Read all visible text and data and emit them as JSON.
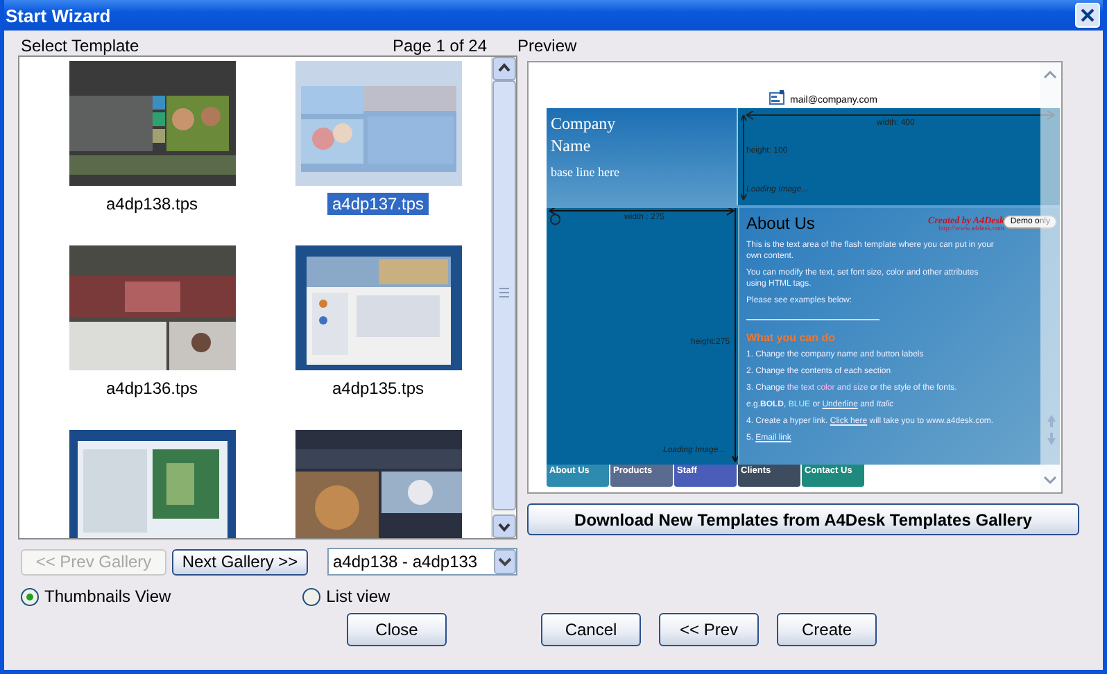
{
  "window": {
    "title": "Start Wizard"
  },
  "select_label": "Select Template",
  "page_label": "Page 1 of 24",
  "preview_label": "Preview",
  "templates": [
    {
      "label": "a4dp138.tps",
      "selected": false
    },
    {
      "label": "a4dp137.tps",
      "selected": true
    },
    {
      "label": "a4dp136.tps",
      "selected": false
    },
    {
      "label": "a4dp135.tps",
      "selected": false
    },
    {
      "selected": false
    },
    {
      "selected": false
    }
  ],
  "preview": {
    "email": "mail@company.com",
    "company_lines": [
      "Company",
      "Name"
    ],
    "baseline": "base line here",
    "banner": {
      "width_label": "width: 400",
      "height_label": "height: 100",
      "loading": "Loading Image..."
    },
    "side_image": {
      "letter": "O",
      "width_label": "width : 275",
      "height_label": "height:275",
      "loading": "Loading Image..."
    },
    "title": "About Us",
    "credit": "Created by A4Desk",
    "credit_url": "http://www.a4desk.com",
    "demo_badge": "Demo only",
    "paragraphs": [
      "This is the text area of the flash template where you can put in your own content.",
      "You can modify the text, set font size, color and other attributes using HTML tags.",
      "Please see examples below:"
    ],
    "subheading": "What you can do",
    "steps": [
      [
        {
          "kind": "plain",
          "text": "1. Change the company name and button labels"
        }
      ],
      [
        {
          "kind": "plain",
          "text": "2. Change the contents of each section"
        }
      ],
      [
        {
          "kind": "plain",
          "text": "3. Change "
        },
        {
          "kind": "colored",
          "text": "the text ",
          "color": "#e0d8ff"
        },
        {
          "kind": "colored",
          "text": "color ",
          "color": "#ffb0e8"
        },
        {
          "kind": "colored",
          "text": "and size",
          "color": "#e0d8ff"
        },
        {
          "kind": "plain",
          "text": " or the style of the fonts."
        }
      ],
      [
        {
          "kind": "plain",
          "text": "e.g."
        },
        {
          "kind": "bold",
          "text": "BOLD"
        },
        {
          "kind": "plain",
          "text": ", "
        },
        {
          "kind": "colored",
          "text": "BLUE",
          "color": "#a0f4ff"
        },
        {
          "kind": "plain",
          "text": "  or "
        },
        {
          "kind": "underline",
          "text": "Underline"
        },
        {
          "kind": "plain",
          "text": " and "
        },
        {
          "kind": "italic",
          "text": "Italic"
        }
      ],
      [
        {
          "kind": "plain",
          "text": "4. Create a hyper link. "
        },
        {
          "kind": "link",
          "text": "Click here"
        },
        {
          "kind": "plain",
          "text": " will take you to www.a4desk.com."
        }
      ],
      [
        {
          "kind": "plain",
          "text": "5. "
        },
        {
          "kind": "link",
          "text": "Email link"
        }
      ]
    ],
    "nav": [
      {
        "label": "About Us",
        "color": "#2e8bb0"
      },
      {
        "label": "Products",
        "color": "#5b6b90"
      },
      {
        "label": "Staff",
        "color": "#4a5db8"
      },
      {
        "label": "Clients",
        "color": "#3d4c5e"
      },
      {
        "label": "Contact Us",
        "color": "#1e8a7e"
      }
    ]
  },
  "download_button": "Download New Templates from A4Desk Templates Gallery",
  "gallery_buttons": [
    {
      "label": "<< Prev Gallery",
      "disabled": true
    },
    {
      "label": "Next Gallery >>",
      "disabled": false
    }
  ],
  "range_select": {
    "value": "a4dp138 - a4dp133"
  },
  "views": [
    {
      "label": "Thumbnails View",
      "selected": true
    },
    {
      "label": "List view",
      "selected": false
    }
  ],
  "buttons": [
    "Close",
    "Cancel",
    "<< Prev",
    "Create"
  ]
}
